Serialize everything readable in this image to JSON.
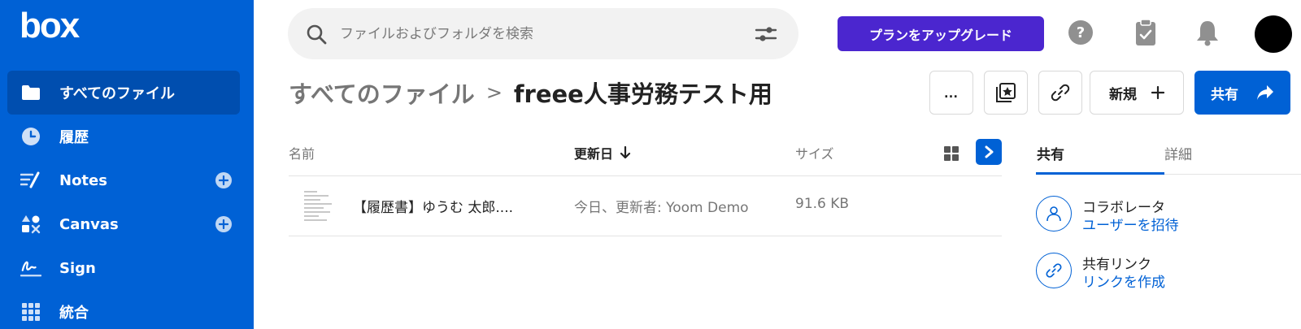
{
  "app": {
    "logo_text": "box"
  },
  "sidebar": {
    "items": [
      {
        "label": "すべてのファイル",
        "icon": "folder-icon",
        "active": true
      },
      {
        "label": "履歴",
        "icon": "clock-icon"
      },
      {
        "label": "Notes",
        "icon": "notes-icon",
        "has_add": true
      },
      {
        "label": "Canvas",
        "icon": "canvas-icon",
        "has_add": true
      },
      {
        "label": "Sign",
        "icon": "sign-icon"
      },
      {
        "label": "統合",
        "icon": "apps-grid-icon"
      }
    ]
  },
  "header": {
    "search_placeholder": "ファイルおよびフォルダを検索",
    "upgrade_label": "プランをアップグレード"
  },
  "breadcrumb": {
    "root": "すべてのファイル",
    "separator": ">",
    "current": "freee人事労務テスト用"
  },
  "toolbar": {
    "more_label": "…",
    "new_label": "新規",
    "share_label": "共有"
  },
  "file_list": {
    "columns": {
      "name": "名前",
      "date": "更新日",
      "size": "サイズ"
    },
    "rows": [
      {
        "name": "【履歴書】ゆうむ 太郎....",
        "updated": "今日、更新者: Yoom Demo",
        "size": "91.6 KB"
      }
    ]
  },
  "right_panel": {
    "tabs": [
      "共有",
      "詳細"
    ],
    "active_tab": "共有",
    "collaborators": {
      "title": "コラボレータ",
      "link": "ユーザーを招待"
    },
    "shared_link": {
      "title": "共有リンク",
      "link": "リンクを作成"
    }
  },
  "colors": {
    "brand_blue": "#0061d5",
    "sidebar_active": "#004eaf",
    "upgrade_purple": "#4b26cf"
  }
}
